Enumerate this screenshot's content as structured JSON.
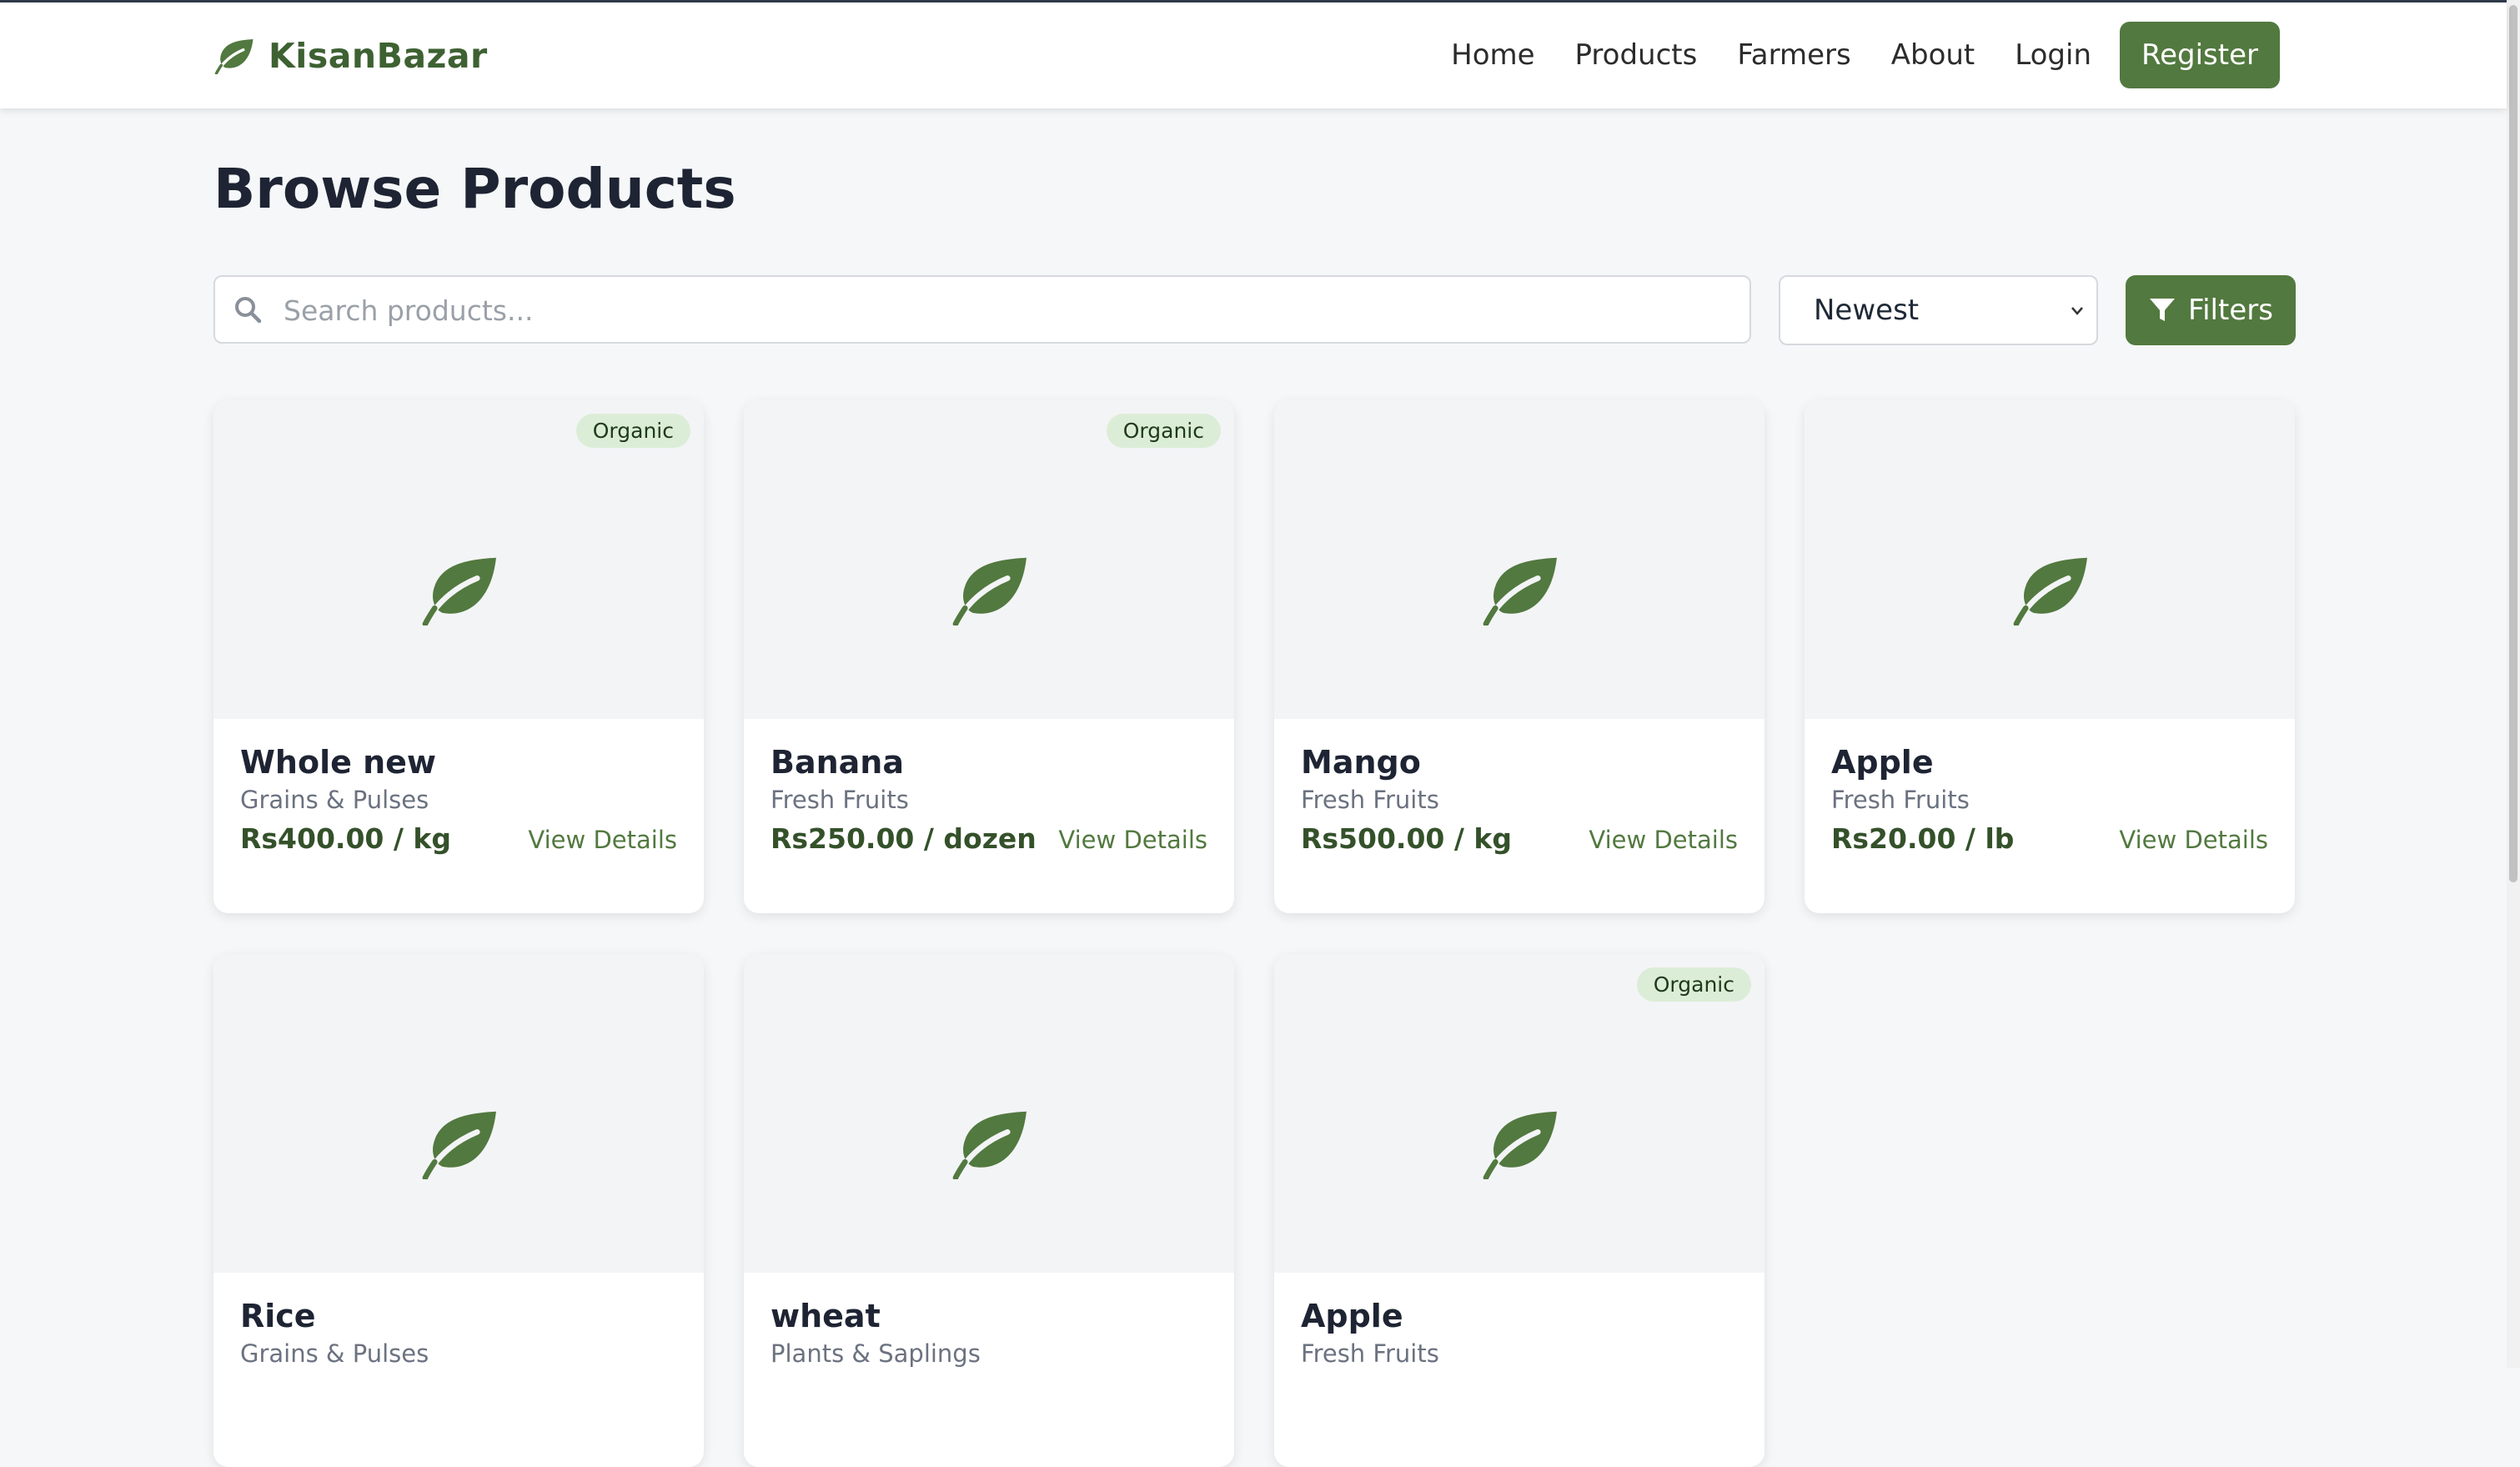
{
  "brand": {
    "name": "KisanBazar"
  },
  "nav": {
    "links": [
      "Home",
      "Products",
      "Farmers",
      "About",
      "Login"
    ],
    "register": "Register"
  },
  "page": {
    "title": "Browse Products"
  },
  "search": {
    "placeholder": "Search products...",
    "value": ""
  },
  "sort": {
    "selected": "Newest"
  },
  "filters": {
    "label": "Filters"
  },
  "colors": {
    "accent": "#52793f",
    "brand": "#3e6132",
    "badge": "#dcedd7"
  },
  "products": [
    {
      "name": "Whole new",
      "category": "Grains & Pulses",
      "price": "Rs400.00 / kg",
      "badge": "Organic",
      "action": "View Details"
    },
    {
      "name": "Banana",
      "category": "Fresh Fruits",
      "price": "Rs250.00 / dozen",
      "badge": "Organic",
      "action": "View Details"
    },
    {
      "name": "Mango",
      "category": "Fresh Fruits",
      "price": "Rs500.00 / kg",
      "badge": "",
      "action": "View Details"
    },
    {
      "name": "Apple",
      "category": "Fresh Fruits",
      "price": "Rs20.00 / lb",
      "badge": "",
      "action": "View Details"
    },
    {
      "name": "Rice",
      "category": "Grains & Pulses",
      "price": "",
      "badge": "",
      "action": ""
    },
    {
      "name": "wheat",
      "category": "Plants & Saplings",
      "price": "",
      "badge": "",
      "action": ""
    },
    {
      "name": "Apple",
      "category": "Fresh Fruits",
      "price": "",
      "badge": "Organic",
      "action": ""
    }
  ]
}
